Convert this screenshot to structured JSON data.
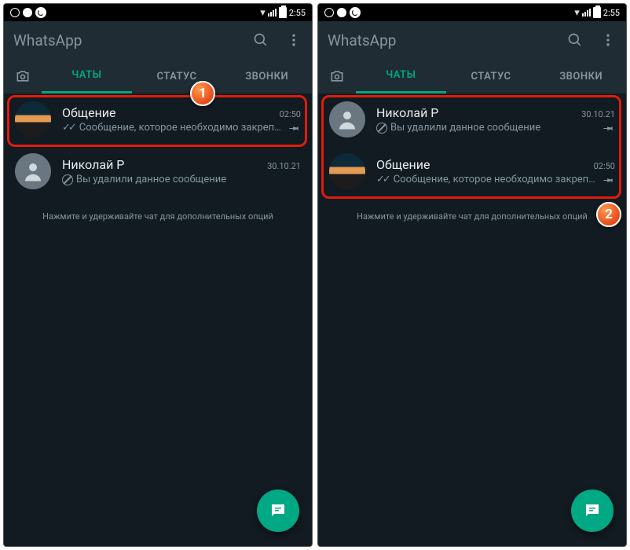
{
  "statusbar": {
    "time": "2:55"
  },
  "left": {
    "title": "WhatsApp",
    "tabs": {
      "chats": "ЧАТЫ",
      "status": "СТАТУС",
      "calls": "ЗВОНКИ"
    },
    "chats": [
      {
        "name": "Общение",
        "time": "02:50",
        "msg": "Сообщение, которое необходимо закреп…",
        "pinned": true,
        "ticks": true,
        "avatar": "landscape"
      },
      {
        "name": "Николай Р",
        "time": "30.10.21",
        "msg": "Вы удалили данное сообщение",
        "pinned": false,
        "blocked": true,
        "avatar": "person"
      }
    ],
    "hint": "Нажмите и удерживайте чат для дополнительных опций",
    "callout": "1"
  },
  "right": {
    "title": "WhatsApp",
    "tabs": {
      "chats": "ЧАТЫ",
      "status": "СТАТУС",
      "calls": "ЗВОНКИ"
    },
    "chats": [
      {
        "name": "Николай Р",
        "time": "30.10.21",
        "msg": "Вы удалили данное сообщение",
        "pinned": true,
        "blocked": true,
        "avatar": "person"
      },
      {
        "name": "Общение",
        "time": "02:50",
        "msg": "Сообщение, которое необходимо закреп…",
        "pinned": true,
        "ticks": true,
        "avatar": "landscape"
      }
    ],
    "hint": "Нажмите и удерживайте чат для дополнительных опций",
    "callout": "2"
  }
}
